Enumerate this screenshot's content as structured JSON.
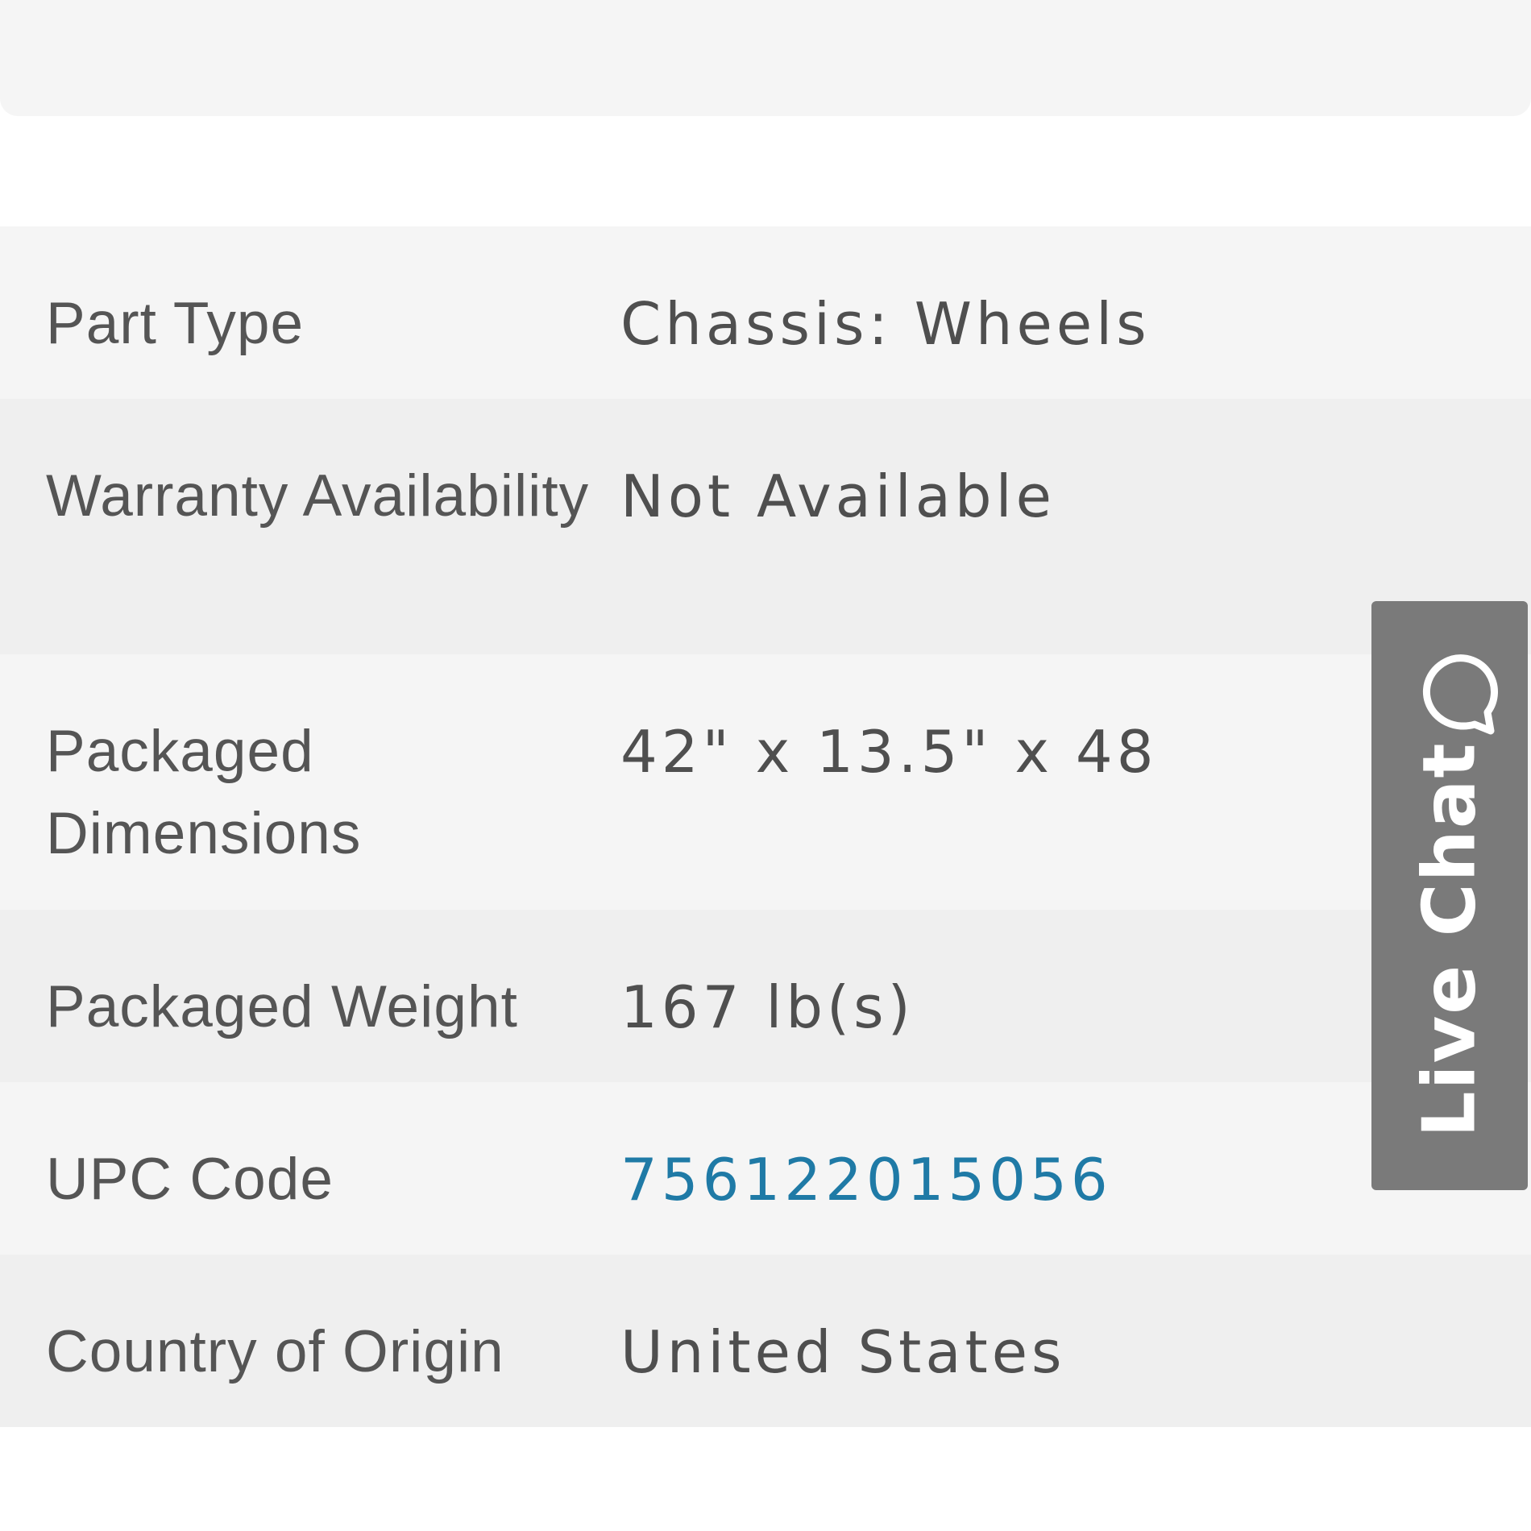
{
  "specs": [
    {
      "label": "Part Type",
      "value": "Chassis: Wheels"
    },
    {
      "label": "Warranty Availability",
      "value": "Not Available"
    },
    {
      "label": "Packaged Dimensions",
      "value": "42\" x 13.5\" x 48"
    },
    {
      "label": "Packaged Weight",
      "value": "167 lb(s)"
    },
    {
      "label": "UPC Code",
      "value": "756122015056"
    },
    {
      "label": "Country of Origin",
      "value": "United States"
    }
  ],
  "live_chat": {
    "label": "Live Chat",
    "icon": "chat-bubble-icon"
  },
  "colors": {
    "row_light": "#f5f5f5",
    "row_dark": "#efefef",
    "text": "#4f4f4f",
    "link": "#1f7aa6",
    "live_chat_bg": "#7a7a7a"
  }
}
